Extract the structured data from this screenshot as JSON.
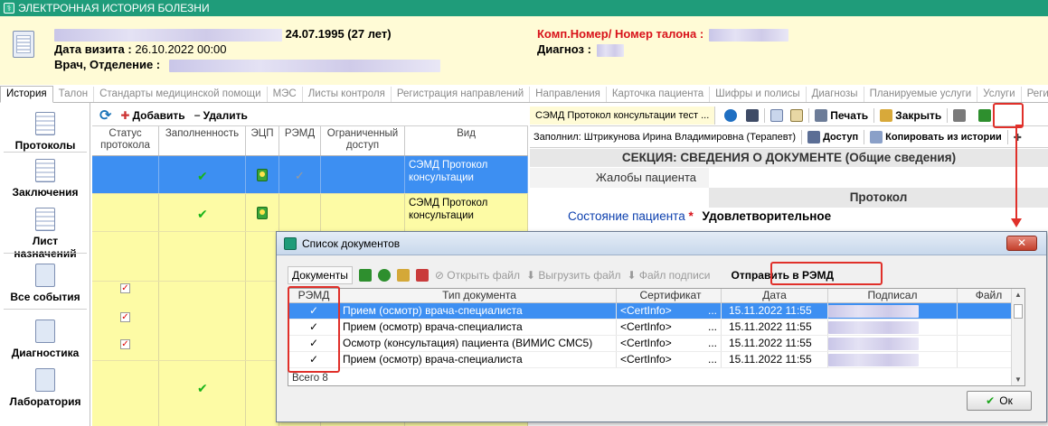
{
  "window_title": "ЭЛЕКТРОННАЯ ИСТОРИЯ БОЛЕЗНИ",
  "patient": {
    "birth": "24.07.1995 (27 лет)",
    "visit_label": "Дата визита :",
    "visit_value": "26.10.2022 00:00",
    "doctor_label": "Врач, Отделение :",
    "comp_label": "Комп.Номер/ Номер талона :",
    "diag_label": "Диагноз :"
  },
  "tabs": [
    "История",
    "Талон",
    "Стандарты медицинской помощи",
    "МЭС",
    "Листы контроля",
    "Регистрация направлений",
    "Направления",
    "Карточка пациента",
    "Шифры и полисы",
    "Диагнозы",
    "Планируемые услуги",
    "Услуги",
    "Регистры"
  ],
  "leftnav": [
    "Протоколы",
    "Заключения",
    "Лист назначений",
    "Все события",
    "Диагностика",
    "Лаборатория"
  ],
  "grid": {
    "add": "Добавить",
    "delete": "Удалить",
    "headers": [
      "Статус протокола",
      "Заполненность",
      "ЭЦП",
      "РЭМД",
      "Ограниченный доступ",
      "Вид"
    ],
    "rows": [
      {
        "vid": "СЭМД Протокол консультации"
      },
      {
        "vid": "СЭМД Протокол консультации"
      }
    ]
  },
  "right": {
    "doc_tab": "СЭМД Протокол консультации тест ...",
    "print": "Печать",
    "close": "Закрыть",
    "filled_by": "Заполнил: Штрикунова Ирина Владимировна (Терапевт)",
    "access": "Доступ",
    "copy_history": "Копировать из истории",
    "section": "СЕКЦИЯ: СВЕДЕНИЯ О ДОКУМЕНТЕ (Общие сведения)",
    "complaints": "Жалобы пациента",
    "protocol": "Протокол",
    "state_label": "Состояние пациента",
    "state_req": "*",
    "state_value": "Удовлетворительное"
  },
  "dialog": {
    "title": "Список документов",
    "docs_tab": "Документы",
    "open_file": "Открыть файл",
    "upload_file": "Выгрузить файл",
    "sig_file": "Файл подписи",
    "send_remd": "Отправить в РЭМД",
    "headers": [
      "РЭМД",
      "Тип документа",
      "Сертификат",
      "Дата",
      "Подписал",
      "Файл"
    ],
    "rows": [
      {
        "type": "Прием (осмотр) врача-специалиста",
        "cert": "<CertInfo>",
        "date": "15.11.2022 11:55"
      },
      {
        "type": "Прием (осмотр) врача-специалиста",
        "cert": "<CertInfo>",
        "date": "15.11.2022 11:55"
      },
      {
        "type": "Осмотр (консультация) пациента (ВИМИС СМС5)",
        "cert": "<CertInfo>",
        "date": "15.11.2022 11:55"
      },
      {
        "type": "Прием (осмотр) врача-специалиста",
        "cert": "<CertInfo>",
        "date": "15.11.2022 11:55"
      }
    ],
    "total": "Всего 8",
    "ok": "Ок",
    "dots": "...",
    "close_x": "✕"
  },
  "colors": {
    "title_bar": "#1f9c7a",
    "header_bg": "#fffbd6",
    "selection": "#3d8ff2",
    "row_yellow": "#fdfba5",
    "annotation_red": "#e0302a"
  }
}
